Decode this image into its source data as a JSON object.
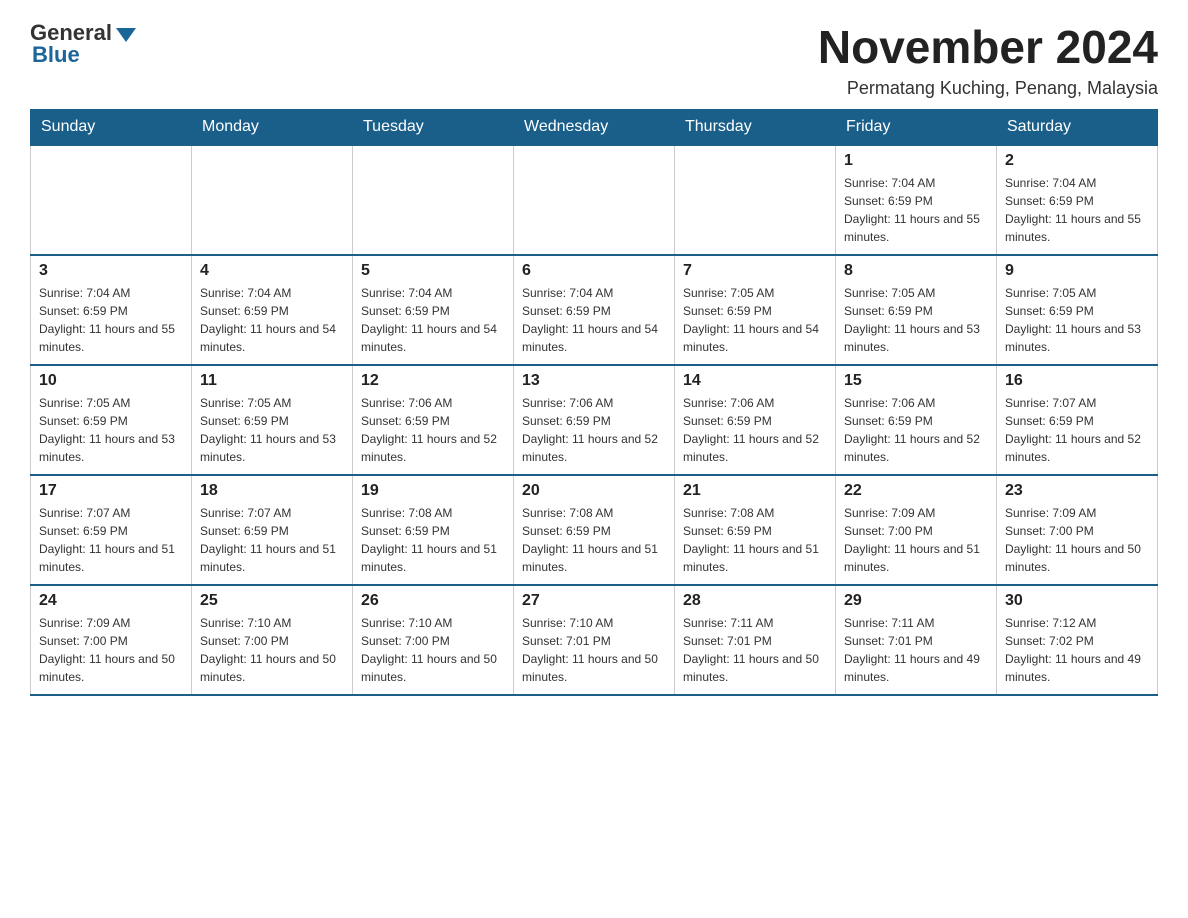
{
  "header": {
    "logo_general": "General",
    "logo_blue": "Blue",
    "month_title": "November 2024",
    "location": "Permatang Kuching, Penang, Malaysia"
  },
  "days_of_week": [
    "Sunday",
    "Monday",
    "Tuesday",
    "Wednesday",
    "Thursday",
    "Friday",
    "Saturday"
  ],
  "weeks": [
    [
      {
        "day": "",
        "info": ""
      },
      {
        "day": "",
        "info": ""
      },
      {
        "day": "",
        "info": ""
      },
      {
        "day": "",
        "info": ""
      },
      {
        "day": "",
        "info": ""
      },
      {
        "day": "1",
        "info": "Sunrise: 7:04 AM\nSunset: 6:59 PM\nDaylight: 11 hours and 55 minutes."
      },
      {
        "day": "2",
        "info": "Sunrise: 7:04 AM\nSunset: 6:59 PM\nDaylight: 11 hours and 55 minutes."
      }
    ],
    [
      {
        "day": "3",
        "info": "Sunrise: 7:04 AM\nSunset: 6:59 PM\nDaylight: 11 hours and 55 minutes."
      },
      {
        "day": "4",
        "info": "Sunrise: 7:04 AM\nSunset: 6:59 PM\nDaylight: 11 hours and 54 minutes."
      },
      {
        "day": "5",
        "info": "Sunrise: 7:04 AM\nSunset: 6:59 PM\nDaylight: 11 hours and 54 minutes."
      },
      {
        "day": "6",
        "info": "Sunrise: 7:04 AM\nSunset: 6:59 PM\nDaylight: 11 hours and 54 minutes."
      },
      {
        "day": "7",
        "info": "Sunrise: 7:05 AM\nSunset: 6:59 PM\nDaylight: 11 hours and 54 minutes."
      },
      {
        "day": "8",
        "info": "Sunrise: 7:05 AM\nSunset: 6:59 PM\nDaylight: 11 hours and 53 minutes."
      },
      {
        "day": "9",
        "info": "Sunrise: 7:05 AM\nSunset: 6:59 PM\nDaylight: 11 hours and 53 minutes."
      }
    ],
    [
      {
        "day": "10",
        "info": "Sunrise: 7:05 AM\nSunset: 6:59 PM\nDaylight: 11 hours and 53 minutes."
      },
      {
        "day": "11",
        "info": "Sunrise: 7:05 AM\nSunset: 6:59 PM\nDaylight: 11 hours and 53 minutes."
      },
      {
        "day": "12",
        "info": "Sunrise: 7:06 AM\nSunset: 6:59 PM\nDaylight: 11 hours and 52 minutes."
      },
      {
        "day": "13",
        "info": "Sunrise: 7:06 AM\nSunset: 6:59 PM\nDaylight: 11 hours and 52 minutes."
      },
      {
        "day": "14",
        "info": "Sunrise: 7:06 AM\nSunset: 6:59 PM\nDaylight: 11 hours and 52 minutes."
      },
      {
        "day": "15",
        "info": "Sunrise: 7:06 AM\nSunset: 6:59 PM\nDaylight: 11 hours and 52 minutes."
      },
      {
        "day": "16",
        "info": "Sunrise: 7:07 AM\nSunset: 6:59 PM\nDaylight: 11 hours and 52 minutes."
      }
    ],
    [
      {
        "day": "17",
        "info": "Sunrise: 7:07 AM\nSunset: 6:59 PM\nDaylight: 11 hours and 51 minutes."
      },
      {
        "day": "18",
        "info": "Sunrise: 7:07 AM\nSunset: 6:59 PM\nDaylight: 11 hours and 51 minutes."
      },
      {
        "day": "19",
        "info": "Sunrise: 7:08 AM\nSunset: 6:59 PM\nDaylight: 11 hours and 51 minutes."
      },
      {
        "day": "20",
        "info": "Sunrise: 7:08 AM\nSunset: 6:59 PM\nDaylight: 11 hours and 51 minutes."
      },
      {
        "day": "21",
        "info": "Sunrise: 7:08 AM\nSunset: 6:59 PM\nDaylight: 11 hours and 51 minutes."
      },
      {
        "day": "22",
        "info": "Sunrise: 7:09 AM\nSunset: 7:00 PM\nDaylight: 11 hours and 51 minutes."
      },
      {
        "day": "23",
        "info": "Sunrise: 7:09 AM\nSunset: 7:00 PM\nDaylight: 11 hours and 50 minutes."
      }
    ],
    [
      {
        "day": "24",
        "info": "Sunrise: 7:09 AM\nSunset: 7:00 PM\nDaylight: 11 hours and 50 minutes."
      },
      {
        "day": "25",
        "info": "Sunrise: 7:10 AM\nSunset: 7:00 PM\nDaylight: 11 hours and 50 minutes."
      },
      {
        "day": "26",
        "info": "Sunrise: 7:10 AM\nSunset: 7:00 PM\nDaylight: 11 hours and 50 minutes."
      },
      {
        "day": "27",
        "info": "Sunrise: 7:10 AM\nSunset: 7:01 PM\nDaylight: 11 hours and 50 minutes."
      },
      {
        "day": "28",
        "info": "Sunrise: 7:11 AM\nSunset: 7:01 PM\nDaylight: 11 hours and 50 minutes."
      },
      {
        "day": "29",
        "info": "Sunrise: 7:11 AM\nSunset: 7:01 PM\nDaylight: 11 hours and 49 minutes."
      },
      {
        "day": "30",
        "info": "Sunrise: 7:12 AM\nSunset: 7:02 PM\nDaylight: 11 hours and 49 minutes."
      }
    ]
  ]
}
